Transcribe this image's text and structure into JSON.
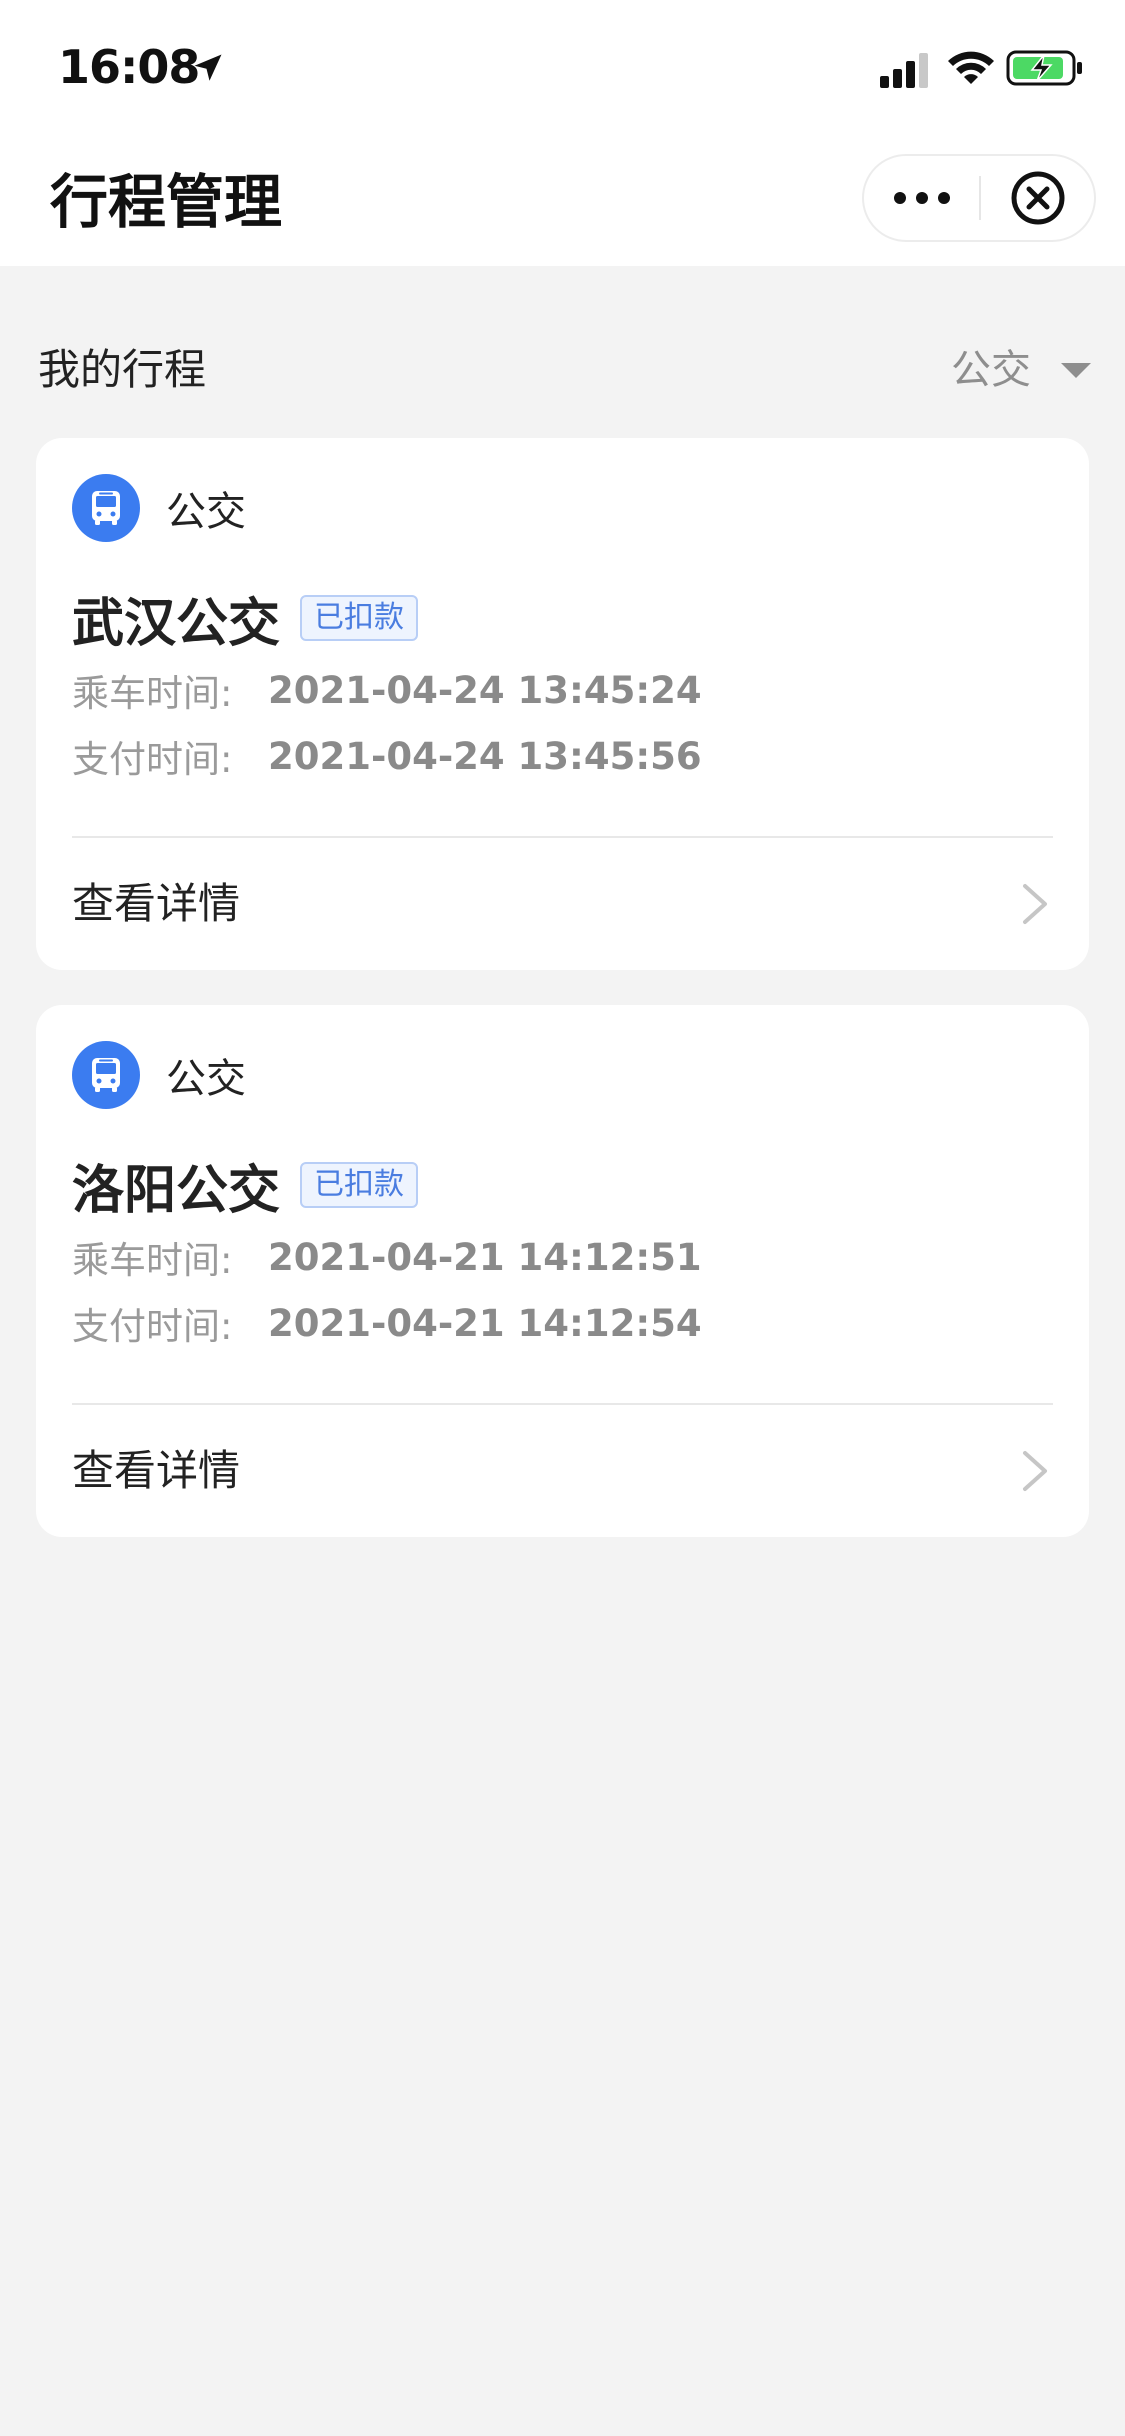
{
  "status_bar": {
    "time": "16:08"
  },
  "nav": {
    "title": "行程管理"
  },
  "section": {
    "title": "我的行程",
    "filter_label": "公交"
  },
  "trips": [
    {
      "type_label": "公交",
      "title": "武汉公交",
      "badge": "已扣款",
      "ride_label": "乘车时间:",
      "ride_time": "2021-04-24 13:45:24",
      "pay_label": "支付时间:",
      "pay_time": "2021-04-24 13:45:56",
      "detail_label": "查看详情"
    },
    {
      "type_label": "公交",
      "title": "洛阳公交",
      "badge": "已扣款",
      "ride_label": "乘车时间:",
      "ride_time": "2021-04-21 14:12:51",
      "pay_label": "支付时间:",
      "pay_time": "2021-04-21 14:12:54",
      "detail_label": "查看详情"
    }
  ],
  "colors": {
    "accent": "#3b7cf0",
    "badge_text": "#4a7de0",
    "background": "#f3f3f3"
  }
}
